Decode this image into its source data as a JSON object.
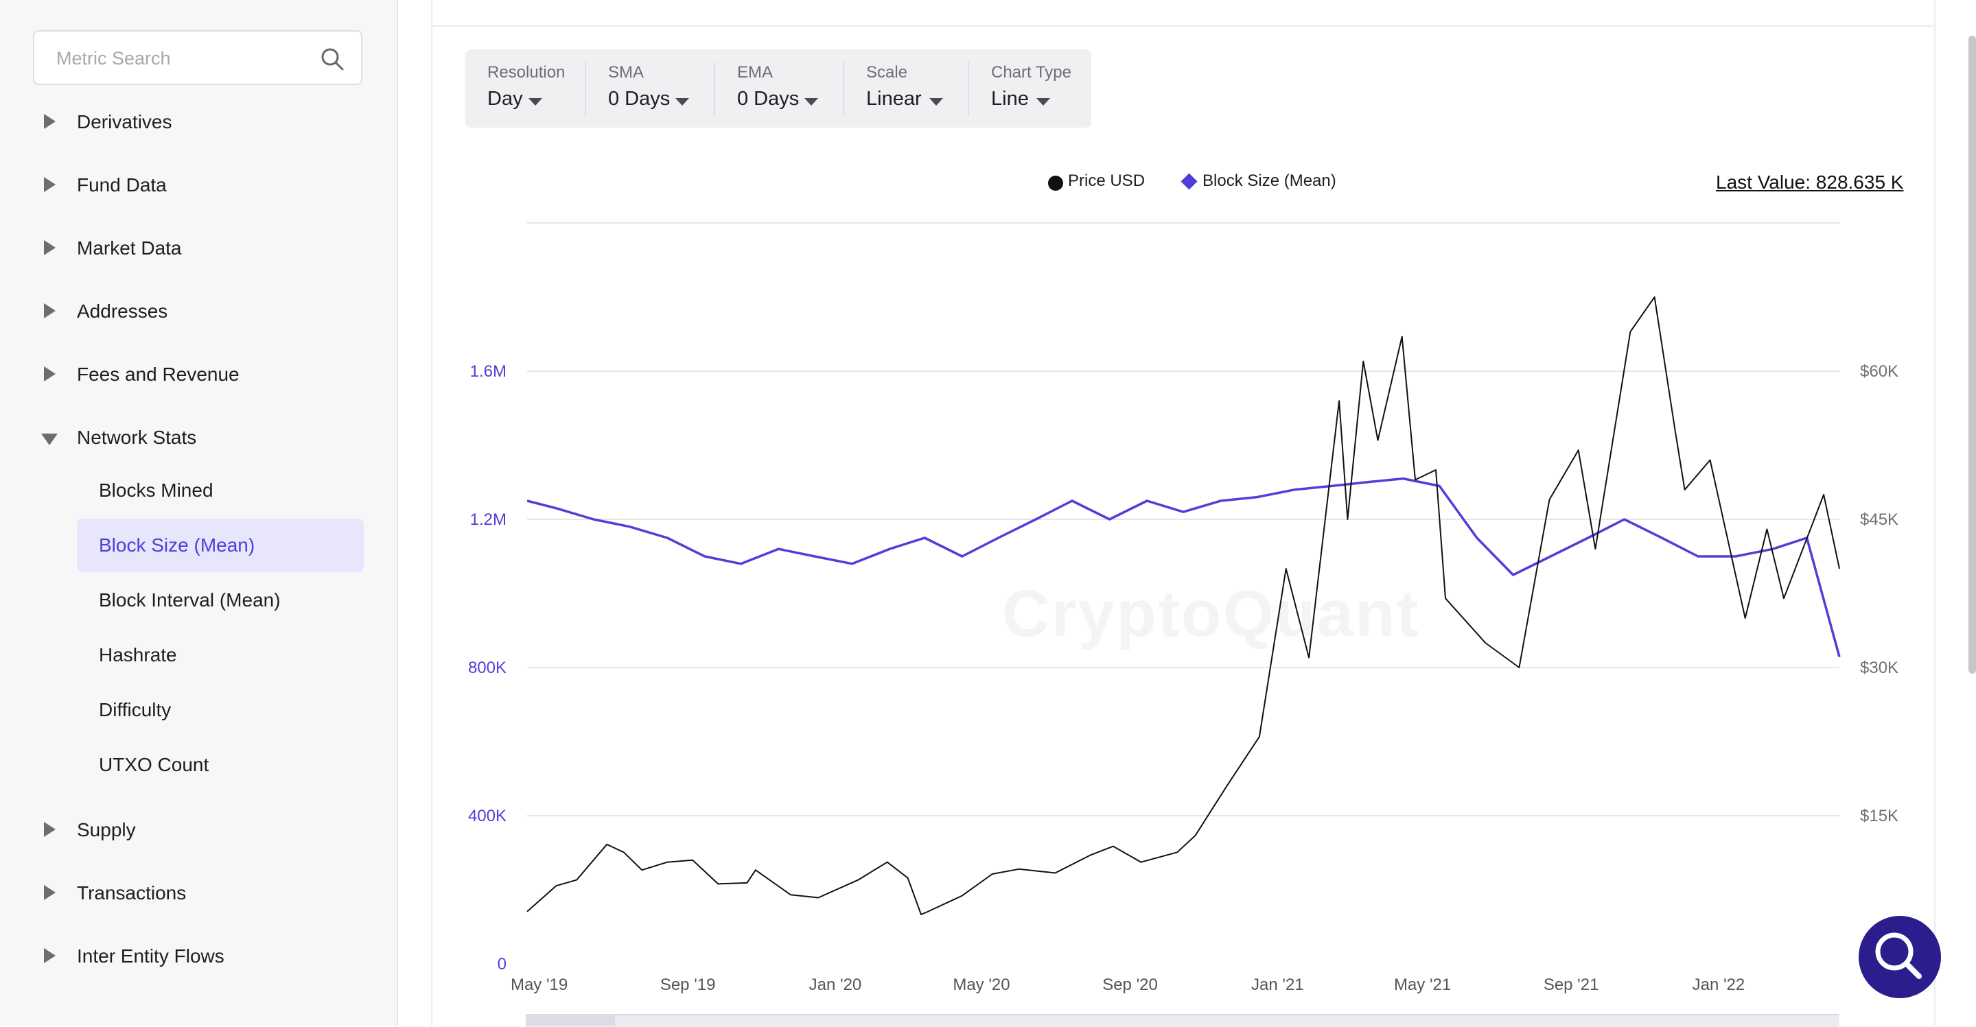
{
  "search": {
    "placeholder": "Metric Search"
  },
  "sidebar": {
    "categories": [
      {
        "label": "Derivatives"
      },
      {
        "label": "Fund Data"
      },
      {
        "label": "Market Data"
      },
      {
        "label": "Addresses"
      },
      {
        "label": "Fees and Revenue"
      },
      {
        "label": "Network Stats"
      },
      {
        "label": "Supply"
      },
      {
        "label": "Transactions"
      },
      {
        "label": "Inter Entity Flows"
      }
    ],
    "network_stats_items": [
      {
        "label": "Blocks Mined"
      },
      {
        "label": "Block Size (Mean)"
      },
      {
        "label": "Block Interval (Mean)"
      },
      {
        "label": "Hashrate"
      },
      {
        "label": "Difficulty"
      },
      {
        "label": "UTXO Count"
      }
    ]
  },
  "controls": [
    {
      "label": "Resolution",
      "value": "Day"
    },
    {
      "label": "SMA",
      "value": "0 Days"
    },
    {
      "label": "EMA",
      "value": "0 Days"
    },
    {
      "label": "Scale",
      "value": "Linear"
    },
    {
      "label": "Chart Type",
      "value": "Line"
    }
  ],
  "legend": {
    "price": "Price USD",
    "block_size": "Block Size (Mean)"
  },
  "last_value": "Last Value: 828.635 K",
  "watermark": "CryptoQuant",
  "colors": {
    "accent": "#4f3fd8",
    "price_line": "#111111",
    "fab": "#2b1d8e"
  },
  "chart_data": {
    "type": "line",
    "x_ticks": [
      "May '19",
      "Sep '19",
      "Jan '20",
      "May '20",
      "Sep '20",
      "Jan '21",
      "May '21",
      "Sep '21",
      "Jan '22"
    ],
    "y_left_ticks": [
      "0",
      "400K",
      "800K",
      "1.2M",
      "1.6M"
    ],
    "y_right_ticks": [
      "$15K",
      "$30K",
      "$45K",
      "$60K"
    ],
    "y_left_range": [
      0,
      2000000
    ],
    "y_right_range": [
      0,
      75000
    ],
    "x_range": [
      "2019-04-21",
      "2022-04-11"
    ],
    "grid": true,
    "legend_position": "top-center",
    "series": [
      {
        "name": "Price USD",
        "axis": "right",
        "x": [
          "2019-04-21",
          "2019-05-15",
          "2019-06-01",
          "2019-06-26",
          "2019-07-10",
          "2019-07-25",
          "2019-08-15",
          "2019-09-05",
          "2019-09-26",
          "2019-10-20",
          "2019-10-27",
          "2019-11-25",
          "2019-12-18",
          "2020-01-20",
          "2020-02-13",
          "2020-03-01",
          "2020-03-12",
          "2020-03-16",
          "2020-04-15",
          "2020-05-10",
          "2020-06-01",
          "2020-07-01",
          "2020-07-30",
          "2020-08-18",
          "2020-09-10",
          "2020-10-10",
          "2020-10-25",
          "2020-11-20",
          "2020-12-17",
          "2021-01-08",
          "2021-01-27",
          "2021-02-21",
          "2021-02-28",
          "2021-03-13",
          "2021-03-25",
          "2021-04-14",
          "2021-04-25",
          "2021-05-12",
          "2021-05-20",
          "2021-06-22",
          "2021-07-20",
          "2021-08-14",
          "2021-09-07",
          "2021-09-21",
          "2021-10-20",
          "2021-11-09",
          "2021-11-26",
          "2021-12-04",
          "2021-12-25",
          "2022-01-23",
          "2022-02-10",
          "2022-02-24",
          "2022-03-29",
          "2022-04-11"
        ],
        "values": [
          5300,
          7900,
          8500,
          12100,
          11300,
          9500,
          10300,
          10500,
          8100,
          8200,
          9500,
          7000,
          6700,
          8500,
          10300,
          8700,
          5000,
          5200,
          6900,
          9100,
          9600,
          9200,
          11000,
          11900,
          10300,
          11300,
          13000,
          18000,
          23000,
          40000,
          31000,
          57000,
          45000,
          61000,
          53000,
          63500,
          49000,
          50000,
          37000,
          32500,
          30000,
          47000,
          52000,
          42000,
          64000,
          67500,
          54000,
          48000,
          51000,
          35000,
          44000,
          37000,
          47500,
          40000
        ]
      },
      {
        "name": "Block Size (Mean)",
        "axis": "left",
        "x": [
          "2019-04-21",
          "2019-05-15",
          "2019-06-15",
          "2019-07-15",
          "2019-08-15",
          "2019-09-15",
          "2019-10-15",
          "2019-11-15",
          "2019-12-15",
          "2020-01-15",
          "2020-02-15",
          "2020-03-15",
          "2020-04-15",
          "2020-05-15",
          "2020-06-15",
          "2020-07-15",
          "2020-08-15",
          "2020-09-15",
          "2020-10-15",
          "2020-11-15",
          "2020-12-15",
          "2021-01-15",
          "2021-02-15",
          "2021-03-15",
          "2021-04-15",
          "2021-05-15",
          "2021-06-15",
          "2021-07-15",
          "2021-08-15",
          "2021-09-15",
          "2021-10-15",
          "2021-11-15",
          "2021-12-15",
          "2022-01-15",
          "2022-02-15",
          "2022-03-15",
          "2022-04-11"
        ],
        "values": [
          1250000,
          1230000,
          1200000,
          1180000,
          1150000,
          1100000,
          1080000,
          1120000,
          1100000,
          1080000,
          1120000,
          1150000,
          1100000,
          1150000,
          1200000,
          1250000,
          1200000,
          1250000,
          1220000,
          1250000,
          1260000,
          1280000,
          1290000,
          1300000,
          1310000,
          1290000,
          1150000,
          1050000,
          1100000,
          1150000,
          1200000,
          1150000,
          1100000,
          1100000,
          1120000,
          1150000,
          828635
        ]
      }
    ]
  }
}
